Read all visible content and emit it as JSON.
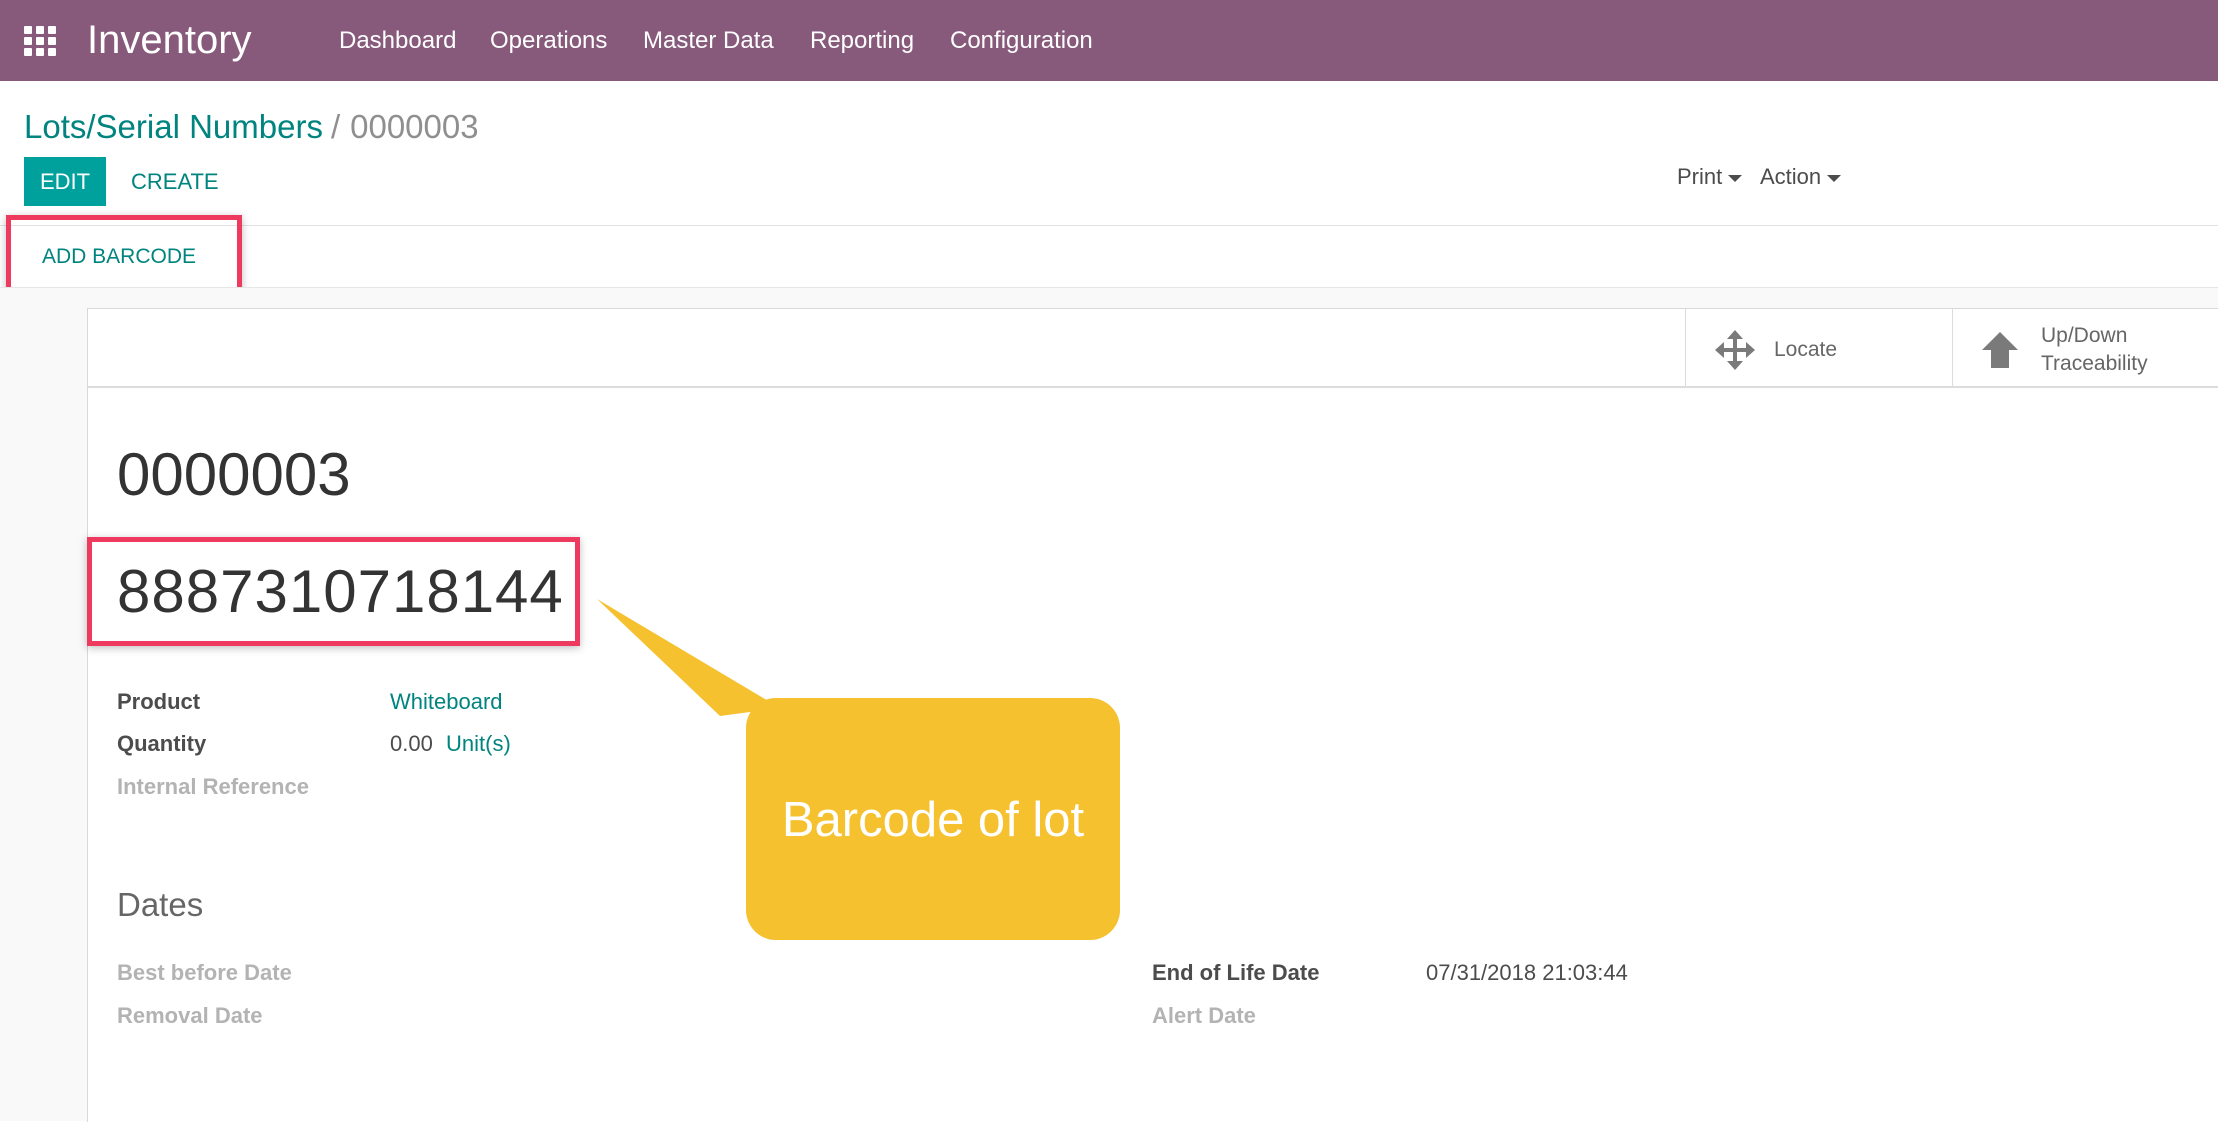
{
  "navbar": {
    "app_title": "Inventory",
    "menu": [
      "Dashboard",
      "Operations",
      "Master Data",
      "Reporting",
      "Configuration"
    ],
    "background_color": "#875a7b",
    "apps_icon": "grid-icon"
  },
  "breadcrumb": {
    "parent": "Lots/Serial Numbers",
    "separator": "/",
    "current": "0000003"
  },
  "control_panel": {
    "edit_label": "EDIT",
    "create_label": "CREATE",
    "print_label": "Print",
    "action_label": "Action"
  },
  "statusbar": {
    "add_barcode_label": "ADD BARCODE"
  },
  "smart_buttons": {
    "locate_label": "Locate",
    "locate_icon": "arrows-move-icon",
    "traceability_label_line1": "Up/Down",
    "traceability_label_line2": "Traceability",
    "traceability_icon": "arrow-up-icon"
  },
  "record": {
    "name": "0000003",
    "barcode": "8887310718144",
    "product_label": "Product",
    "product_value": "Whiteboard",
    "quantity_label": "Quantity",
    "quantity_value": "0.00",
    "quantity_uom": "Unit(s)",
    "internal_ref_label": "Internal Reference"
  },
  "dates": {
    "section_title": "Dates",
    "best_before_label": "Best before Date",
    "removal_label": "Removal Date",
    "end_of_life_label": "End of Life Date",
    "end_of_life_value": "07/31/2018 21:03:44",
    "alert_label": "Alert Date"
  },
  "annotation": {
    "callout_text": "Barcode of lot",
    "callout_color": "#f5c12e",
    "highlight_color": "#ee3a5f"
  },
  "colors": {
    "accent": "#00a09d",
    "link": "#00847f"
  }
}
